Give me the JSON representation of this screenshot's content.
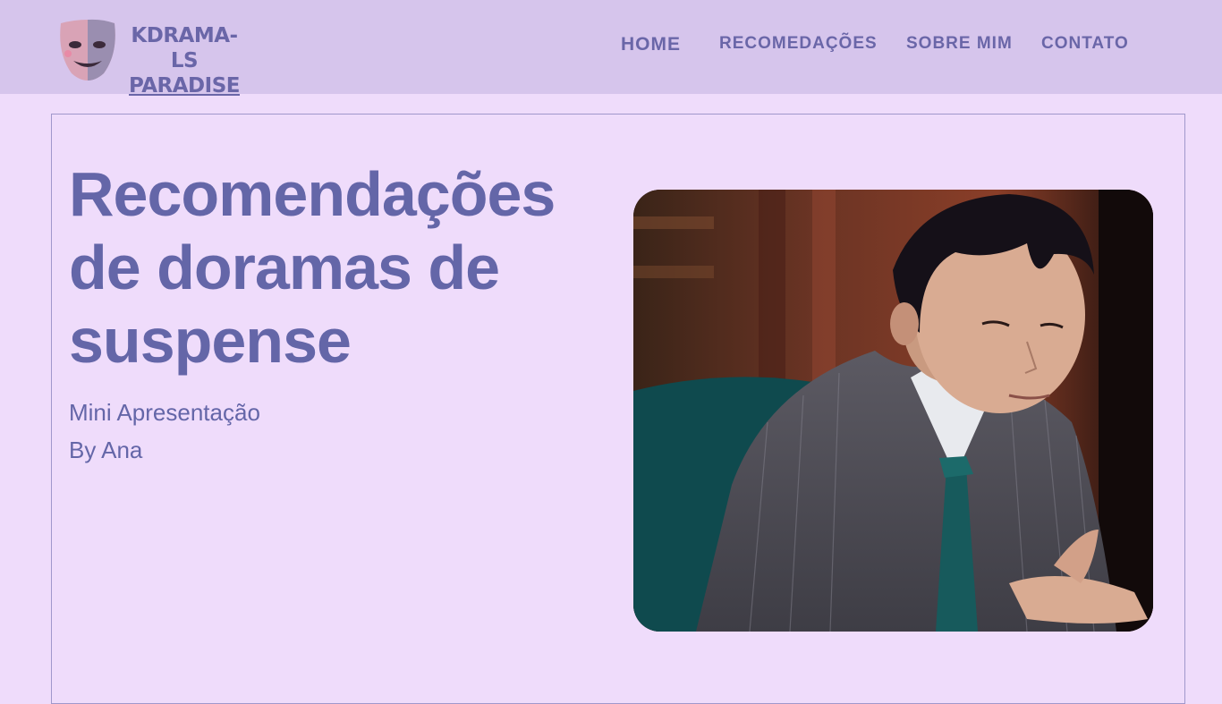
{
  "header": {
    "logo_line1": "KDRAMA-LS",
    "logo_line2": "PARADISE",
    "logo_icon": "drama-mask-icon"
  },
  "nav": {
    "home": "HOME",
    "recommendations": "RECOMEDAÇÕES",
    "about": "SOBRE MIM",
    "contact": "CONTATO"
  },
  "hero": {
    "title": "Recomendações de doramas de suspense",
    "subtitle1": "Mini Apresentação",
    "subtitle2": "By Ana"
  },
  "colors": {
    "header_bg": "#d6c5ec",
    "page_bg": "#efdcfb",
    "accent": "#6466a8"
  }
}
